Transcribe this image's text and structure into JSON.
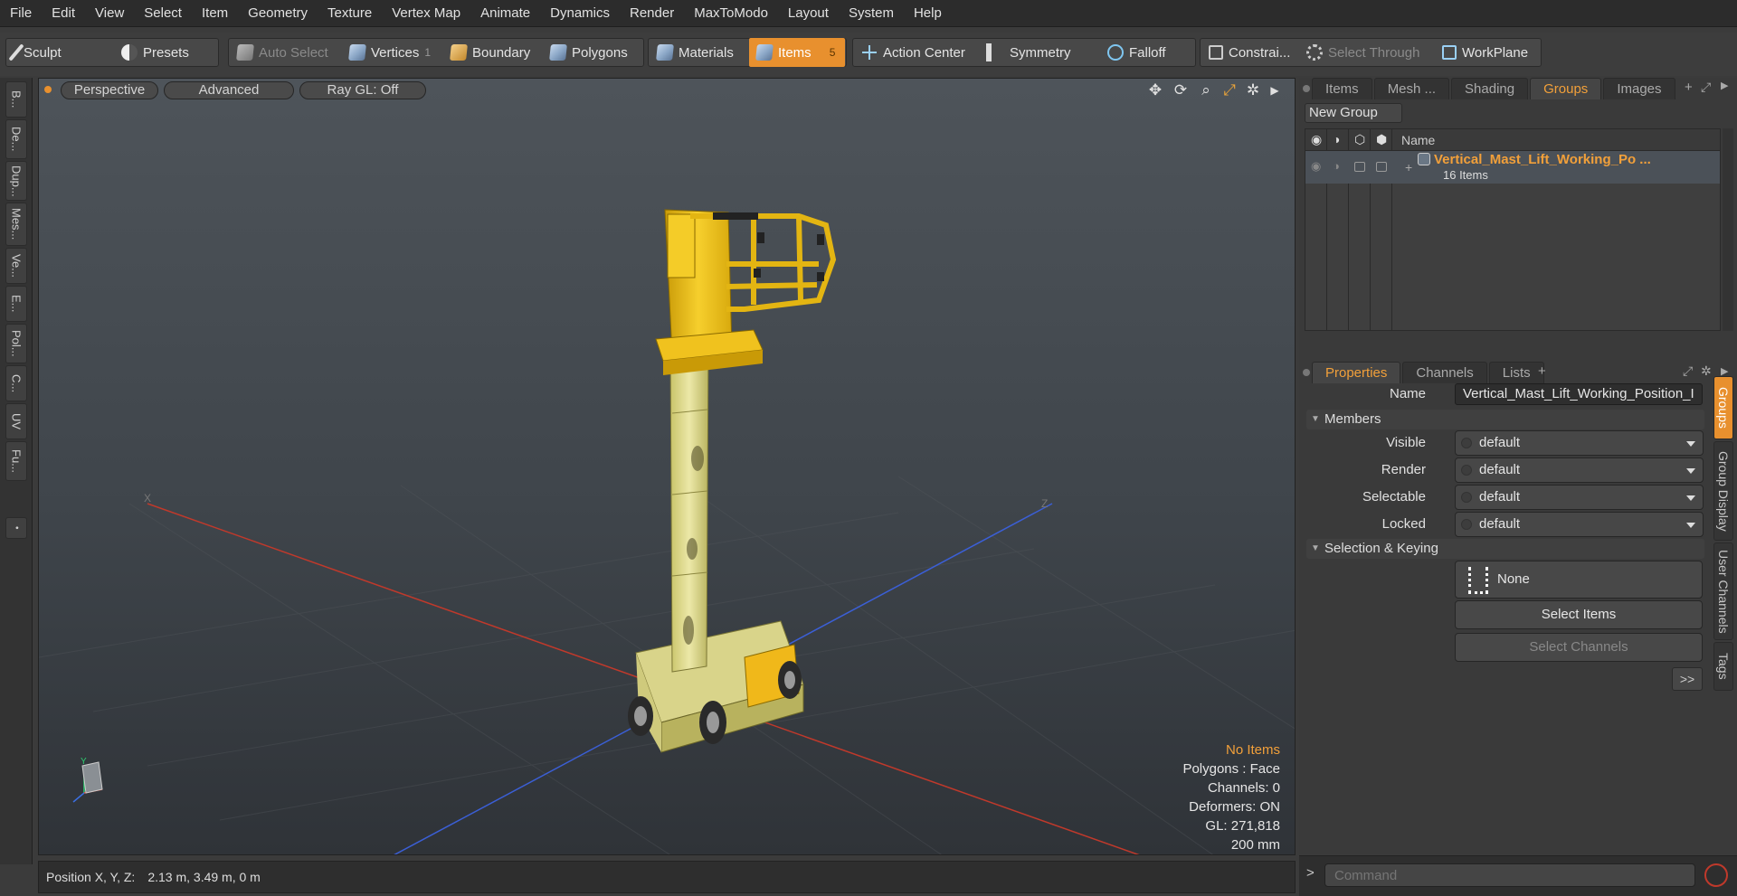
{
  "menu": [
    "File",
    "Edit",
    "View",
    "Select",
    "Item",
    "Geometry",
    "Texture",
    "Vertex Map",
    "Animate",
    "Dynamics",
    "Render",
    "MaxToModo",
    "Layout",
    "System",
    "Help"
  ],
  "toolbar": {
    "sculpt": "Sculpt",
    "presets": "Presets",
    "auto_select": "Auto Select",
    "vertices": "Vertices",
    "vertices_count": "1",
    "boundary": "Boundary",
    "polygons": "Polygons",
    "materials": "Materials",
    "items": "Items",
    "items_count": "5",
    "action_center": "Action Center",
    "symmetry": "Symmetry",
    "falloff": "Falloff",
    "constraints": "Constrai...",
    "select_through": "Select Through",
    "workplane": "WorkPlane"
  },
  "left_tabs": [
    "B...",
    "De...",
    "Dup...",
    "Mes...",
    "Ve...",
    "E...",
    "Pol...",
    "C...",
    "UV",
    "Fu..."
  ],
  "viewport": {
    "perspective": "Perspective",
    "advanced": "Advanced",
    "raygl": "Ray GL: Off",
    "stats": {
      "no_items": "No Items",
      "polygons": "Polygons : Face",
      "channels": "Channels: 0",
      "deformers": "Deformers: ON",
      "gl": "GL: 271,818",
      "scale": "200 mm"
    },
    "axis_x": "X",
    "axis_z": "Z",
    "gizmo_y": "Y",
    "colors": {
      "lift_yellow": "#f1c40f",
      "x_axis": "#c0392b",
      "z_axis": "#3b5fd6"
    }
  },
  "status": {
    "label": "Position X, Y, Z:",
    "value": "2.13 m, 3.49 m, 0 m"
  },
  "groups_panel": {
    "tabs": [
      "Items",
      "Mesh ...",
      "Shading",
      "Groups",
      "Images"
    ],
    "active_tab": "Groups",
    "new_group": "New Group",
    "col_name": "Name",
    "group_name": "Vertical_Mast_Lift_Working_Po ...",
    "group_count": "16 Items"
  },
  "properties_panel": {
    "tabs": [
      "Properties",
      "Channels",
      "Lists"
    ],
    "name_label": "Name",
    "name_value": "Vertical_Mast_Lift_Working_Position_I",
    "members": "Members",
    "visible_label": "Visible",
    "visible_value": "default",
    "render_label": "Render",
    "render_value": "default",
    "selectable_label": "Selectable",
    "selectable_value": "default",
    "locked_label": "Locked",
    "locked_value": "default",
    "selection_keying": "Selection & Keying",
    "none": "None",
    "select_items": "Select Items",
    "select_channels": "Select Channels",
    "more": ">>",
    "side_tabs": [
      "Groups",
      "Group Display",
      "User Channels",
      "Tags"
    ]
  },
  "command": {
    "placeholder": "Command",
    "prompt": ">"
  }
}
